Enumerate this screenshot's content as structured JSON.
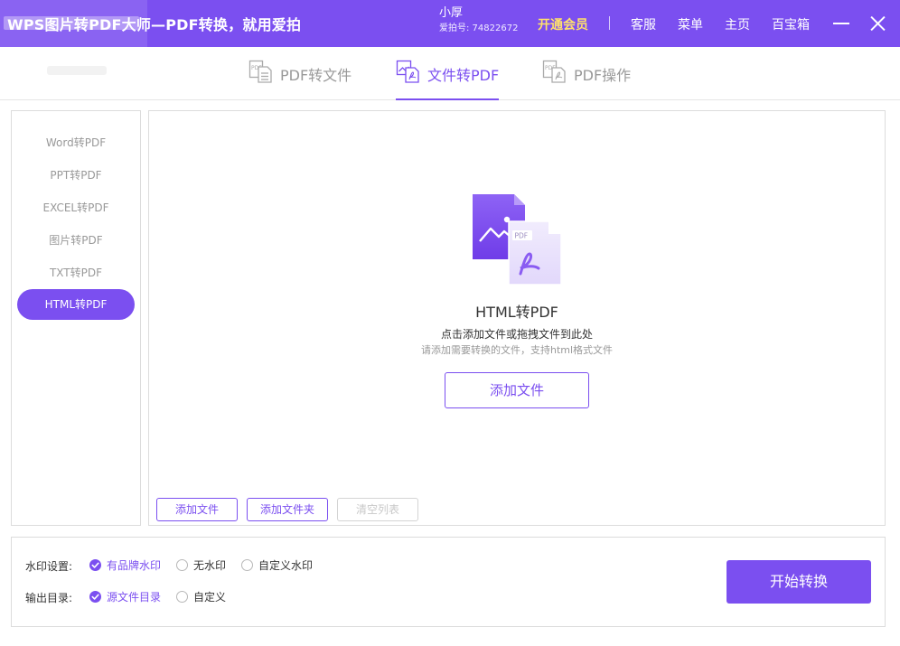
{
  "app": {
    "title": "WPS图片转PDF大师—PDF转换，就用爱拍"
  },
  "user": {
    "name": "小厚",
    "id_text": "爱拍号: 74822672"
  },
  "header_links": {
    "vip": "开通会员",
    "service": "客服",
    "menu": "菜单",
    "home": "主页",
    "toolbox": "百宝箱"
  },
  "tabs": [
    {
      "label": "PDF转文件",
      "icon": "pdf-to-file-icon"
    },
    {
      "label": "文件转PDF",
      "icon": "file-to-pdf-icon"
    },
    {
      "label": "PDF操作",
      "icon": "pdf-operation-icon"
    }
  ],
  "sidebar": {
    "items": [
      {
        "label": "Word转PDF"
      },
      {
        "label": "PPT转PDF"
      },
      {
        "label": "EXCEL转PDF"
      },
      {
        "label": "图片转PDF"
      },
      {
        "label": "TXT转PDF"
      },
      {
        "label": "HTML转PDF"
      }
    ],
    "active_index": 5
  },
  "dropzone": {
    "title": "HTML转PDF",
    "hint": "点击添加文件或拖拽文件到此处",
    "sub_hint": "请添加需要转换的文件，支持html格式文件",
    "add_button": "添加文件",
    "file_badge": "PDF"
  },
  "list_toolbar": {
    "add_file": "添加文件",
    "add_folder": "添加文件夹",
    "clear_list": "清空列表"
  },
  "settings": {
    "watermark_label": "水印设置:",
    "watermark_options": [
      "有品牌水印",
      "无水印",
      "自定义水印"
    ],
    "watermark_selected": 0,
    "output_label": "输出目录:",
    "output_options": [
      "源文件目录",
      "自定义"
    ],
    "output_selected": 0
  },
  "start_button": "开始转换",
  "colors": {
    "accent": "#7b4ff0",
    "vip": "#ffe16b"
  }
}
